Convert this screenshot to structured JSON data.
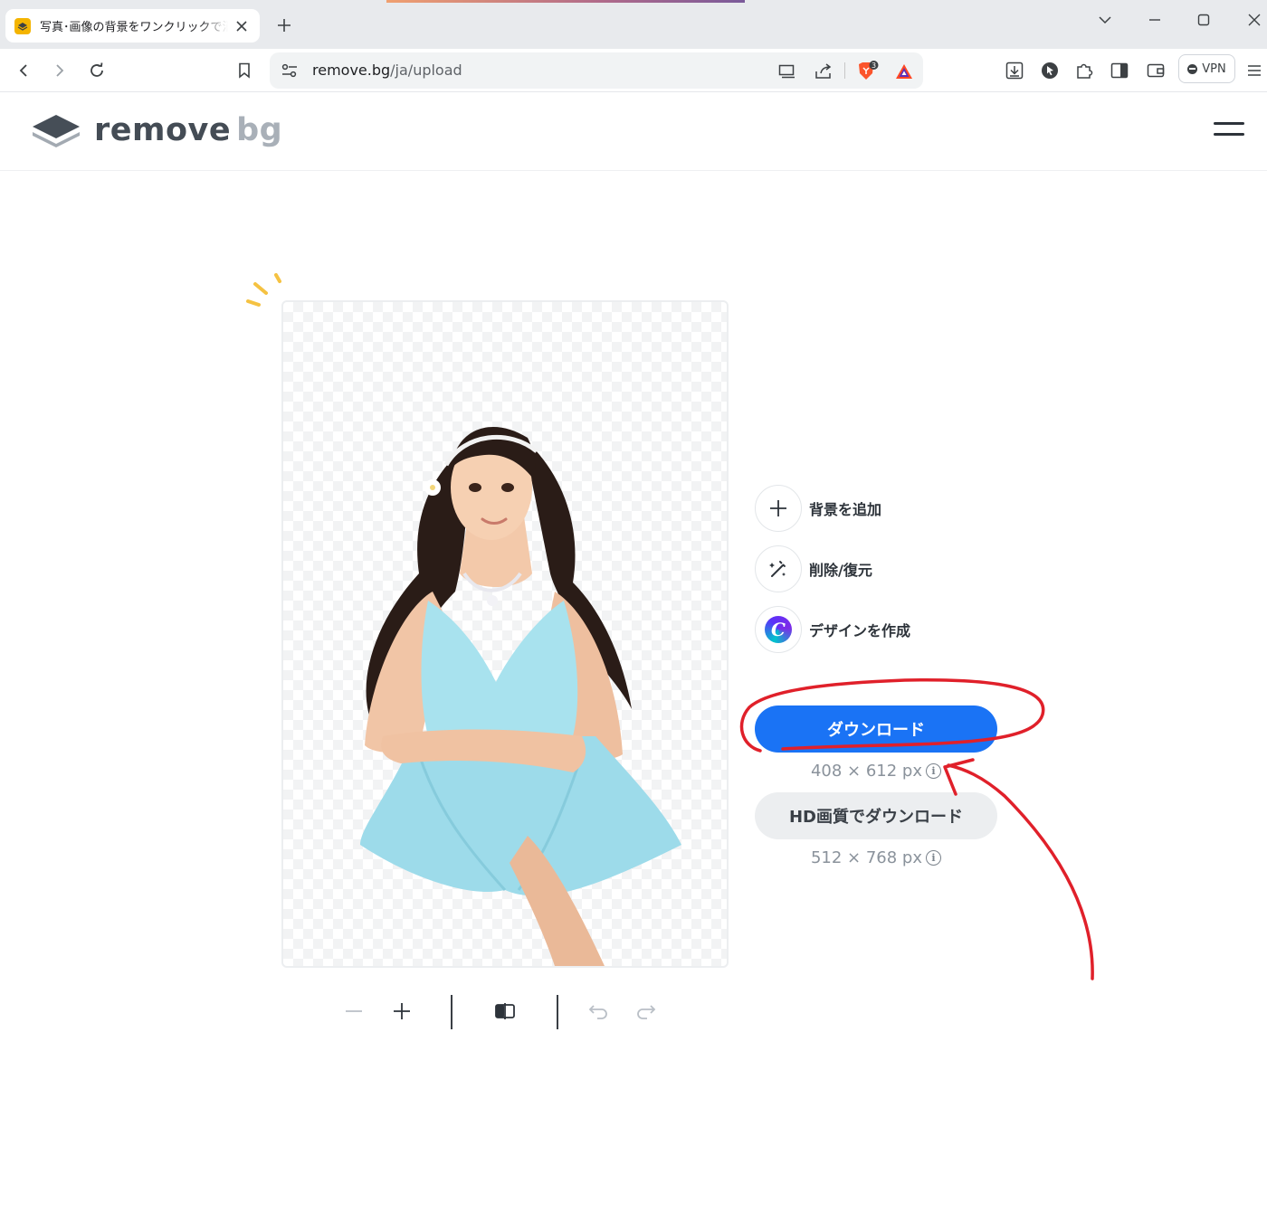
{
  "browser": {
    "tab_title": "写真･画像の背景をワンクリックで消去",
    "url_host": "remove.bg",
    "url_path": "/ja/upload",
    "shields_count": "3",
    "vpn_label": "VPN"
  },
  "site": {
    "logo_word1": "remove",
    "logo_word2": "bg"
  },
  "actions": {
    "add_background": "背景を追加",
    "erase_restore": "削除/復元",
    "create_design": "デザインを作成",
    "canva_letter": "C"
  },
  "download": {
    "button_label": "ダウンロード",
    "size": "408 × 612 px",
    "hd_button_label": "HD画質でダウンロード",
    "hd_size": "512 × 768 px",
    "info_glyph": "i"
  },
  "colors": {
    "primary_button": "#1a73f5",
    "secondary_button": "#eceef0",
    "annotation_red": "#e0202a",
    "sparkle": "#f5c242"
  }
}
